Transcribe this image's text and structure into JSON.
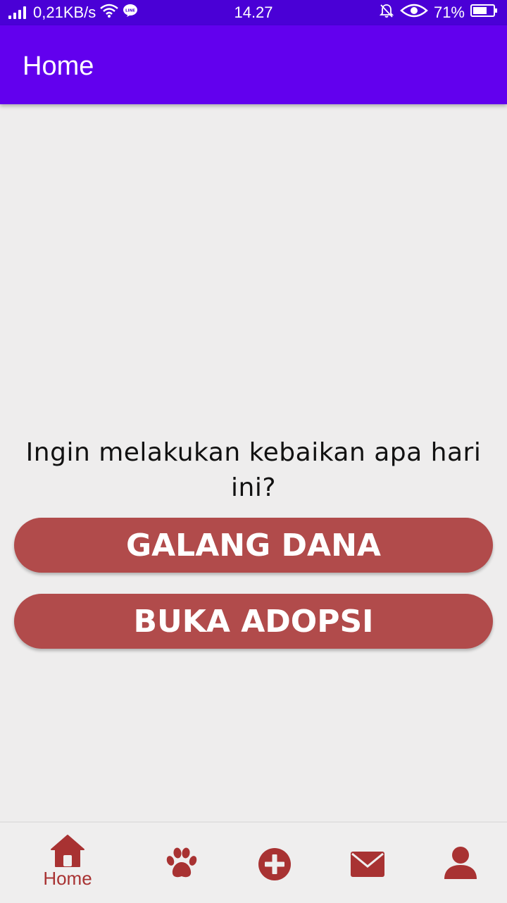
{
  "status_bar": {
    "network_speed": "0,21KB/s",
    "time": "14.27",
    "battery": "71%",
    "icons": [
      "signal-icon",
      "wifi-icon",
      "line-icon",
      "mute-icon",
      "eye-icon",
      "battery-icon"
    ]
  },
  "app_bar": {
    "title": "Home"
  },
  "main": {
    "question": "Ingin melakukan kebaikan apa hari ini?",
    "primary_button": "GALANG DANA",
    "secondary_button": "BUKA ADOPSI"
  },
  "bottom_nav": {
    "items": [
      {
        "icon": "home-icon",
        "label": "Home",
        "selected": true
      },
      {
        "icon": "paw-icon",
        "label": ""
      },
      {
        "icon": "plus-circle-icon",
        "label": ""
      },
      {
        "icon": "mail-icon",
        "label": ""
      },
      {
        "icon": "profile-icon",
        "label": ""
      }
    ]
  },
  "colors": {
    "status_bar": "#4a00d6",
    "app_bar": "#6200ee",
    "button": "#b14b4b",
    "nav_icon": "#a83232",
    "background": "#eeeded"
  }
}
